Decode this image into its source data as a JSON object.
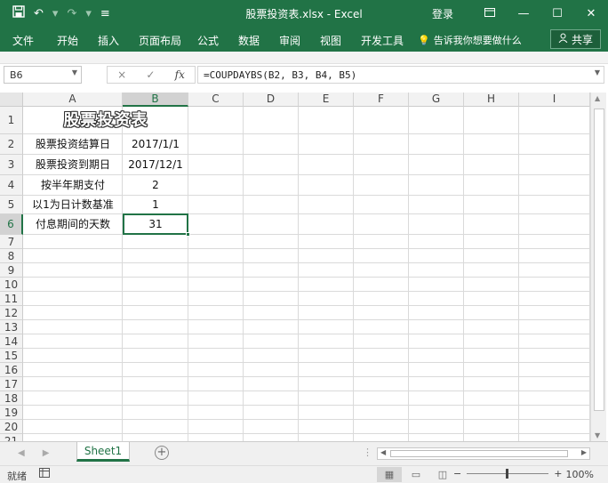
{
  "window": {
    "title": "股票投资表.xlsx  -  Excel",
    "login": "登录",
    "qat": {
      "save_icon": "save-icon",
      "undo": "↶",
      "redo": "↷"
    }
  },
  "menu": {
    "items": [
      "文件",
      "开始",
      "插入",
      "页面布局",
      "公式",
      "数据",
      "审阅",
      "视图",
      "开发工具"
    ],
    "tellme": "告诉我你想要做什么",
    "share": "共享"
  },
  "formula_bar": {
    "name_box": "B6",
    "cancel": "×",
    "enter": "✓",
    "fx": "fx",
    "formula": "=COUPDAYBS(B2, B3, B4, B5)"
  },
  "columns": [
    "A",
    "B",
    "C",
    "D",
    "E",
    "F",
    "G",
    "H",
    "I"
  ],
  "rows": [
    "1",
    "2",
    "3",
    "4",
    "5",
    "6",
    "7",
    "8",
    "9",
    "10",
    "11",
    "12",
    "13",
    "14",
    "15",
    "16",
    "17",
    "18",
    "19",
    "20",
    "21"
  ],
  "sheet": {
    "title": "股票投资表",
    "labels": [
      "股票投资结算日",
      "股票投资到期日",
      "按半年期支付",
      "以1为日计数基准",
      "付息期间的天数"
    ],
    "values": [
      "2017/1/1",
      "2017/12/1",
      "2",
      "1",
      "31"
    ]
  },
  "tabs": {
    "active": "Sheet1",
    "add": "+"
  },
  "status": {
    "ready": "就绪",
    "zoom_minus": "−",
    "zoom_plus": "+",
    "zoom": "100%"
  },
  "colors": {
    "accent": "#217346"
  }
}
